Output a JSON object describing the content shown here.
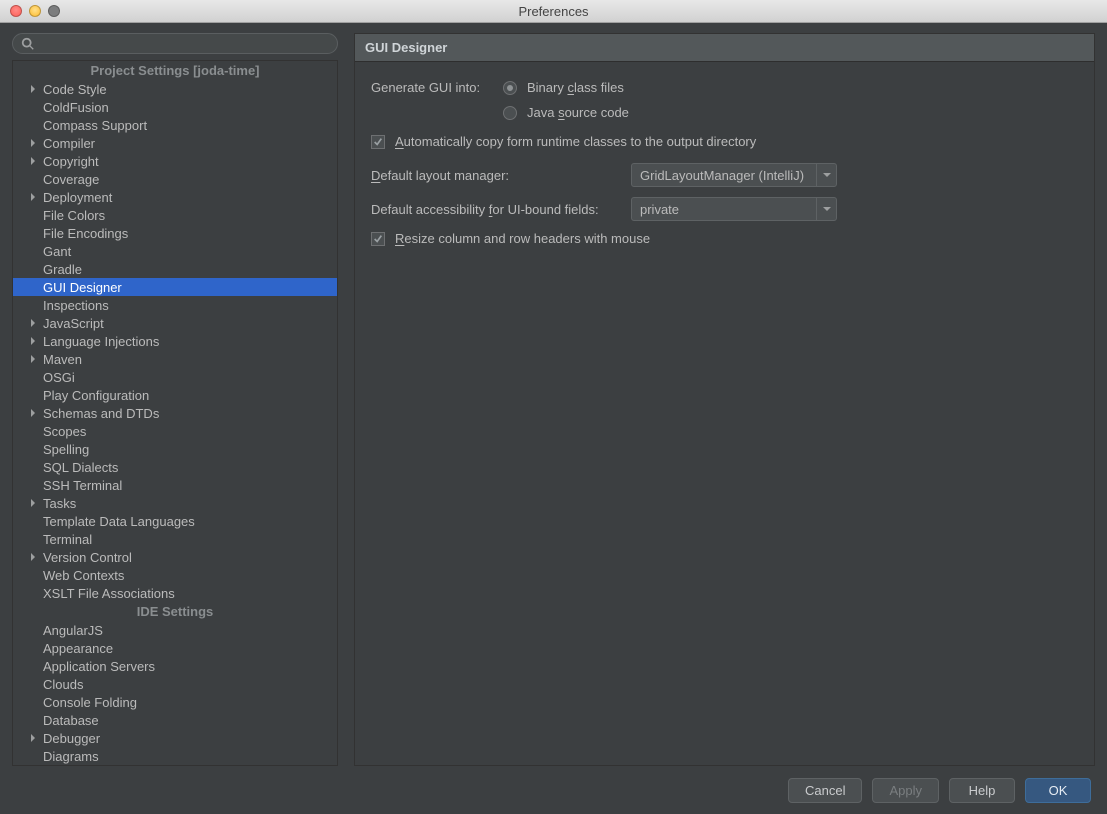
{
  "window": {
    "title": "Preferences"
  },
  "search": {
    "placeholder": ""
  },
  "sidebar": {
    "section1": "Project Settings [joda-time]",
    "section2": "IDE Settings",
    "project_items": [
      {
        "label": "Code Style",
        "arrow": true
      },
      {
        "label": "ColdFusion",
        "arrow": false
      },
      {
        "label": "Compass Support",
        "arrow": false
      },
      {
        "label": "Compiler",
        "arrow": true
      },
      {
        "label": "Copyright",
        "arrow": true
      },
      {
        "label": "Coverage",
        "arrow": false
      },
      {
        "label": "Deployment",
        "arrow": true
      },
      {
        "label": "File Colors",
        "arrow": false
      },
      {
        "label": "File Encodings",
        "arrow": false
      },
      {
        "label": "Gant",
        "arrow": false
      },
      {
        "label": "Gradle",
        "arrow": false
      },
      {
        "label": "GUI Designer",
        "arrow": false,
        "selected": true
      },
      {
        "label": "Inspections",
        "arrow": false
      },
      {
        "label": "JavaScript",
        "arrow": true
      },
      {
        "label": "Language Injections",
        "arrow": true
      },
      {
        "label": "Maven",
        "arrow": true
      },
      {
        "label": "OSGi",
        "arrow": false
      },
      {
        "label": "Play Configuration",
        "arrow": false
      },
      {
        "label": "Schemas and DTDs",
        "arrow": true
      },
      {
        "label": "Scopes",
        "arrow": false
      },
      {
        "label": "Spelling",
        "arrow": false
      },
      {
        "label": "SQL Dialects",
        "arrow": false
      },
      {
        "label": "SSH Terminal",
        "arrow": false
      },
      {
        "label": "Tasks",
        "arrow": true
      },
      {
        "label": "Template Data Languages",
        "arrow": false
      },
      {
        "label": "Terminal",
        "arrow": false
      },
      {
        "label": "Version Control",
        "arrow": true
      },
      {
        "label": "Web Contexts",
        "arrow": false
      },
      {
        "label": "XSLT File Associations",
        "arrow": false
      }
    ],
    "ide_items": [
      {
        "label": "AngularJS",
        "arrow": false
      },
      {
        "label": "Appearance",
        "arrow": false
      },
      {
        "label": "Application Servers",
        "arrow": false
      },
      {
        "label": "Clouds",
        "arrow": false
      },
      {
        "label": "Console Folding",
        "arrow": false
      },
      {
        "label": "Database",
        "arrow": false
      },
      {
        "label": "Debugger",
        "arrow": true
      },
      {
        "label": "Diagrams",
        "arrow": false
      }
    ]
  },
  "panel": {
    "title": "GUI Designer",
    "generate_label": "Generate GUI into:",
    "radio_binary_pre": "Binary ",
    "radio_binary_u": "c",
    "radio_binary_post": "lass files",
    "radio_java_pre": "Java ",
    "radio_java_u": "s",
    "radio_java_post": "ource code",
    "auto_copy_u": "A",
    "auto_copy_post": "utomatically copy form runtime classes to the output directory",
    "layout_u": "D",
    "layout_post": "efault layout manager:",
    "layout_value": "GridLayoutManager (IntelliJ)",
    "access_pre": "Default accessibility ",
    "access_u": "f",
    "access_post": "or UI-bound fields:",
    "access_value": "private",
    "resize_u": "R",
    "resize_post": "esize column and row headers with mouse"
  },
  "footer": {
    "cancel": "Cancel",
    "apply": "Apply",
    "help": "Help",
    "ok": "OK"
  }
}
